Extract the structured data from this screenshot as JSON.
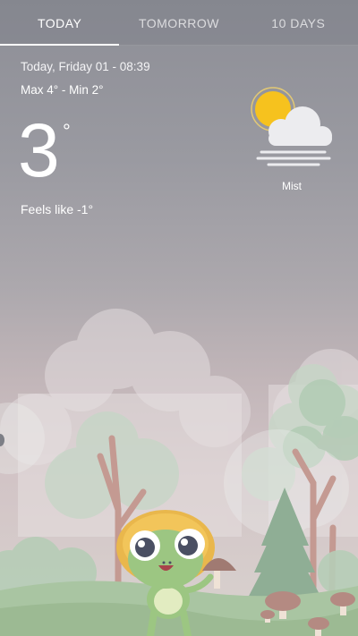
{
  "tabs": [
    {
      "label": "TODAY",
      "active": true
    },
    {
      "label": "TOMORROW",
      "active": false
    },
    {
      "label": "10 DAYS",
      "active": false
    }
  ],
  "weather": {
    "date": "Today, Friday 01 - 08:39",
    "minmax": "Max 4° - Min 2°",
    "temperature": "3",
    "degree_symbol": "°",
    "feels_like": "Feels like -1°",
    "condition": "Mist",
    "icon": "sun-cloud-mist-icon"
  },
  "colors": {
    "sun": "#f6c21e",
    "cloud": "#e9e9ec",
    "tree_green": "#a9c7ad",
    "trunk": "#c19790",
    "frog": "#9cc682"
  }
}
